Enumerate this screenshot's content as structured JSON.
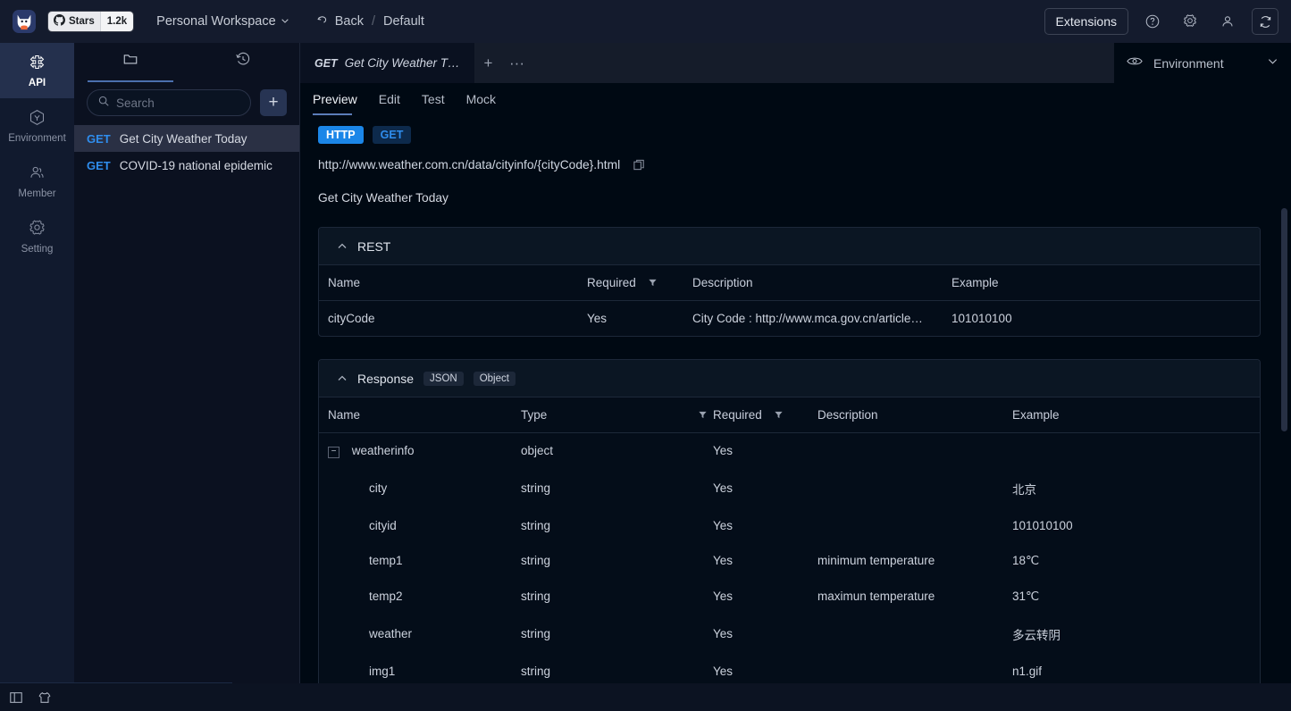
{
  "topbar": {
    "logo_icon": "cat-logo-icon",
    "stars_label": "Stars",
    "stars_count": "1.2k",
    "workspace": "Personal Workspace",
    "back_label": "Back",
    "breadcrumb_sep": "/",
    "breadcrumb_current": "Default",
    "extensions_label": "Extensions",
    "icons": [
      "help-circle-icon",
      "gear-icon",
      "user-icon",
      "refresh-icon"
    ]
  },
  "rail": {
    "items": [
      {
        "label": "API",
        "icon": "api-icon",
        "active": true
      },
      {
        "label": "Environment",
        "icon": "environment-hex-icon",
        "active": false
      },
      {
        "label": "Member",
        "icon": "member-icon",
        "active": false
      },
      {
        "label": "Setting",
        "icon": "gear-icon",
        "active": false
      }
    ]
  },
  "list_panel": {
    "tabs": [
      {
        "name": "folder-tab",
        "icon": "folder-icon",
        "active": true
      },
      {
        "name": "history-tab",
        "icon": "history-clock-icon",
        "active": false
      }
    ],
    "search": {
      "placeholder": "Search",
      "value": ""
    },
    "add_label": "+",
    "items": [
      {
        "method": "GET",
        "title": "Get City Weather Today",
        "selected": true
      },
      {
        "method": "GET",
        "title": "COVID-19 national epidemic",
        "selected": false
      }
    ]
  },
  "tabstrip": {
    "open_tab": {
      "method": "GET",
      "title": "Get City Weather T…"
    },
    "new_tab_label": "+",
    "more_label": "···"
  },
  "env_strip": {
    "eye_icon": "eye-icon",
    "label": "Environment",
    "chevron": "chevron-down-icon"
  },
  "doc": {
    "subtabs": [
      {
        "label": "Preview",
        "active": true
      },
      {
        "label": "Edit",
        "active": false
      },
      {
        "label": "Test",
        "active": false
      },
      {
        "label": "Mock",
        "active": false
      }
    ],
    "badges": {
      "protocol": "HTTP",
      "method": "GET"
    },
    "url": "http://www.weather.com.cn/data/cityinfo/{cityCode}.html",
    "copy_icon": "copy-icon",
    "description": "Get City Weather Today"
  },
  "rest_section": {
    "title": "REST",
    "collapse_icon": "chevron-up-icon",
    "columns": [
      "Name",
      "Required",
      "Description",
      "Example"
    ],
    "required_filter_icon": "filter-icon",
    "rows": [
      {
        "name": "cityCode",
        "required": "Yes",
        "description": "City Code : http://www.mca.gov.cn/article…",
        "example": "101010100"
      }
    ]
  },
  "response_section": {
    "title": "Response",
    "collapse_icon": "chevron-up-icon",
    "badges": [
      "JSON",
      "Object"
    ],
    "columns": [
      "Name",
      "Type",
      "Required",
      "Description",
      "Example"
    ],
    "type_filter_icon": "filter-icon",
    "required_filter_icon": "filter-icon",
    "rows": [
      {
        "name": "weatherinfo",
        "type": "object",
        "required": "Yes",
        "description": "",
        "example": "",
        "indent": 0,
        "toggle": "−"
      },
      {
        "name": "city",
        "type": "string",
        "required": "Yes",
        "description": "",
        "example": "北京",
        "indent": 1,
        "toggle": ""
      },
      {
        "name": "cityid",
        "type": "string",
        "required": "Yes",
        "description": "",
        "example": "101010100",
        "indent": 1,
        "toggle": ""
      },
      {
        "name": "temp1",
        "type": "string",
        "required": "Yes",
        "description": "minimum temperature",
        "example": "18℃",
        "indent": 1,
        "toggle": ""
      },
      {
        "name": "temp2",
        "type": "string",
        "required": "Yes",
        "description": "maximun temperature",
        "example": "31℃",
        "indent": 1,
        "toggle": ""
      },
      {
        "name": "weather",
        "type": "string",
        "required": "Yes",
        "description": "",
        "example": "多云转阴",
        "indent": 1,
        "toggle": ""
      },
      {
        "name": "img1",
        "type": "string",
        "required": "Yes",
        "description": "",
        "example": "n1.gif",
        "indent": 1,
        "toggle": ""
      }
    ]
  },
  "statusbar": {
    "icons": [
      "panel-toggle-icon",
      "theme-shirt-icon"
    ]
  },
  "colors": {
    "accent_blue": "#1b86e8",
    "method_get": "#2f8ded",
    "bg": "#000913",
    "topbar_bg": "#141b2d",
    "rail_bg": "#111a2e",
    "panel_head_bg": "#0b1623",
    "active_rail": "#24304d"
  }
}
